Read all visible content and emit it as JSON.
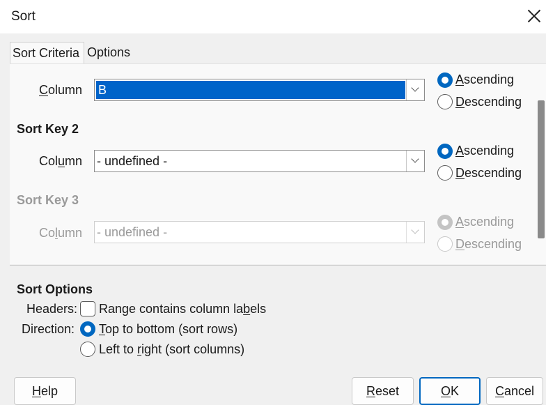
{
  "window": {
    "title": "Sort"
  },
  "tabs": [
    {
      "label": "Sort Criteria"
    },
    {
      "label": "Options"
    }
  ],
  "sort_key_1": {
    "column_label_pre": "",
    "column_label_u": "C",
    "column_label_post": "olumn",
    "value": "B",
    "ascending": {
      "label_u": "A",
      "label_rest": "scending"
    },
    "descending": {
      "label_u": "D",
      "label_rest": "escending"
    },
    "selected": "ascending"
  },
  "sort_key_2": {
    "heading": "Sort Key 2",
    "column_label_pre": "Col",
    "column_label_u": "u",
    "column_label_post": "mn",
    "value": "- undefined -",
    "ascending": {
      "label_u": "A",
      "label_rest": "scending"
    },
    "descending": {
      "label_u": "D",
      "label_rest": "escending"
    },
    "selected": "ascending"
  },
  "sort_key_3": {
    "heading": "Sort Key 3",
    "column_label_pre": "Co",
    "column_label_u": "l",
    "column_label_post": "umn",
    "value": "- undefined -",
    "ascending": {
      "label_u": "A",
      "label_rest": "scending"
    },
    "descending": {
      "label_u": "D",
      "label_rest": "escending"
    },
    "selected": "ascending",
    "disabled": true
  },
  "sort_options": {
    "heading": "Sort Options",
    "headers_label": "Headers:",
    "headers_checkbox": {
      "pre": "Range contains column la",
      "u": "b",
      "post": "els",
      "checked": false
    },
    "direction_label": "Direction:",
    "top_to_bottom": {
      "u": "T",
      "post": "op to bottom (sort rows)",
      "selected": true
    },
    "left_to_right": {
      "pre": "Left to ",
      "u": "r",
      "post": "ight (sort columns)",
      "selected": false
    }
  },
  "buttons": {
    "help": {
      "u": "H",
      "post": "elp"
    },
    "reset": {
      "u": "R",
      "post": "eset"
    },
    "ok": {
      "u": "O",
      "post": "K"
    },
    "cancel": {
      "u": "C",
      "post": "ancel"
    }
  },
  "colors": {
    "accent": "#0067c0",
    "selection": "#0063c9"
  }
}
